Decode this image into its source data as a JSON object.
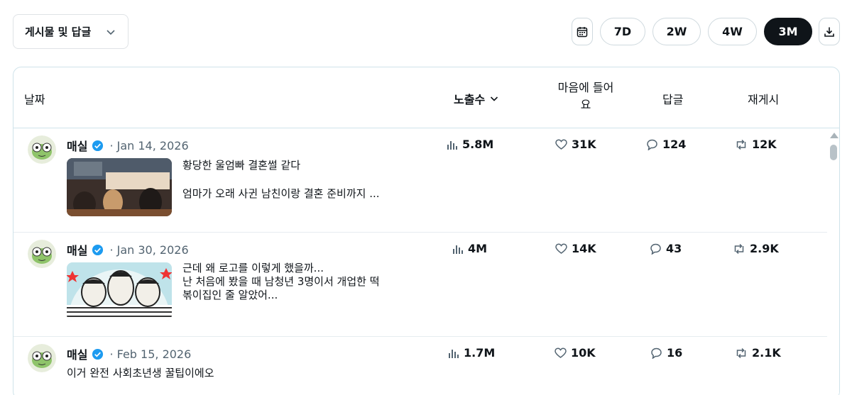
{
  "filter": {
    "label": "게시물 및 답글"
  },
  "ranges": [
    {
      "label": "7D",
      "active": false
    },
    {
      "label": "2W",
      "active": false
    },
    {
      "label": "4W",
      "active": false
    },
    {
      "label": "3M",
      "active": true
    }
  ],
  "icons": {
    "calendar": "calendar-icon",
    "download": "download-icon",
    "impressions": "bar-chart-icon",
    "likes": "heart-icon",
    "replies": "reply-icon",
    "reposts": "repost-icon",
    "verified": "verified-badge-icon"
  },
  "colors": {
    "verified": "#1d9bf0",
    "active_range": "#0f1419",
    "date_text": "#536471"
  },
  "table": {
    "headers": {
      "date": "날짜",
      "impressions": "노출수",
      "likes": "마음에 들어요",
      "replies": "답글",
      "reposts": "재게시"
    },
    "rows": [
      {
        "author": "매실",
        "date": "· Jan 14, 2026",
        "text_line1": "황당한 울엄빠 결혼썰 같다",
        "text_line2": "엄마가 오래 사귄 남친이랑 결혼 준비까지 ...",
        "impressions": "5.8M",
        "likes": "31K",
        "replies": "124",
        "reposts": "12K"
      },
      {
        "author": "매실",
        "date": "· Jan 30, 2026",
        "text_line1": "근데 왜 로고를 이렇게 했을까...",
        "text_line2": "난 처음에 봤을 때 남청년 3명이서 개업한 떡",
        "text_line3": "볶이집인 줄 알았어...",
        "impressions": "4M",
        "likes": "14K",
        "replies": "43",
        "reposts": "2.9K"
      },
      {
        "author": "매실",
        "date": "· Feb 15, 2026",
        "text_line1": "이거 완전 사회초년생 꿀팁이에오",
        "impressions": "1.7M",
        "likes": "10K",
        "replies": "16",
        "reposts": "2.1K"
      }
    ]
  }
}
